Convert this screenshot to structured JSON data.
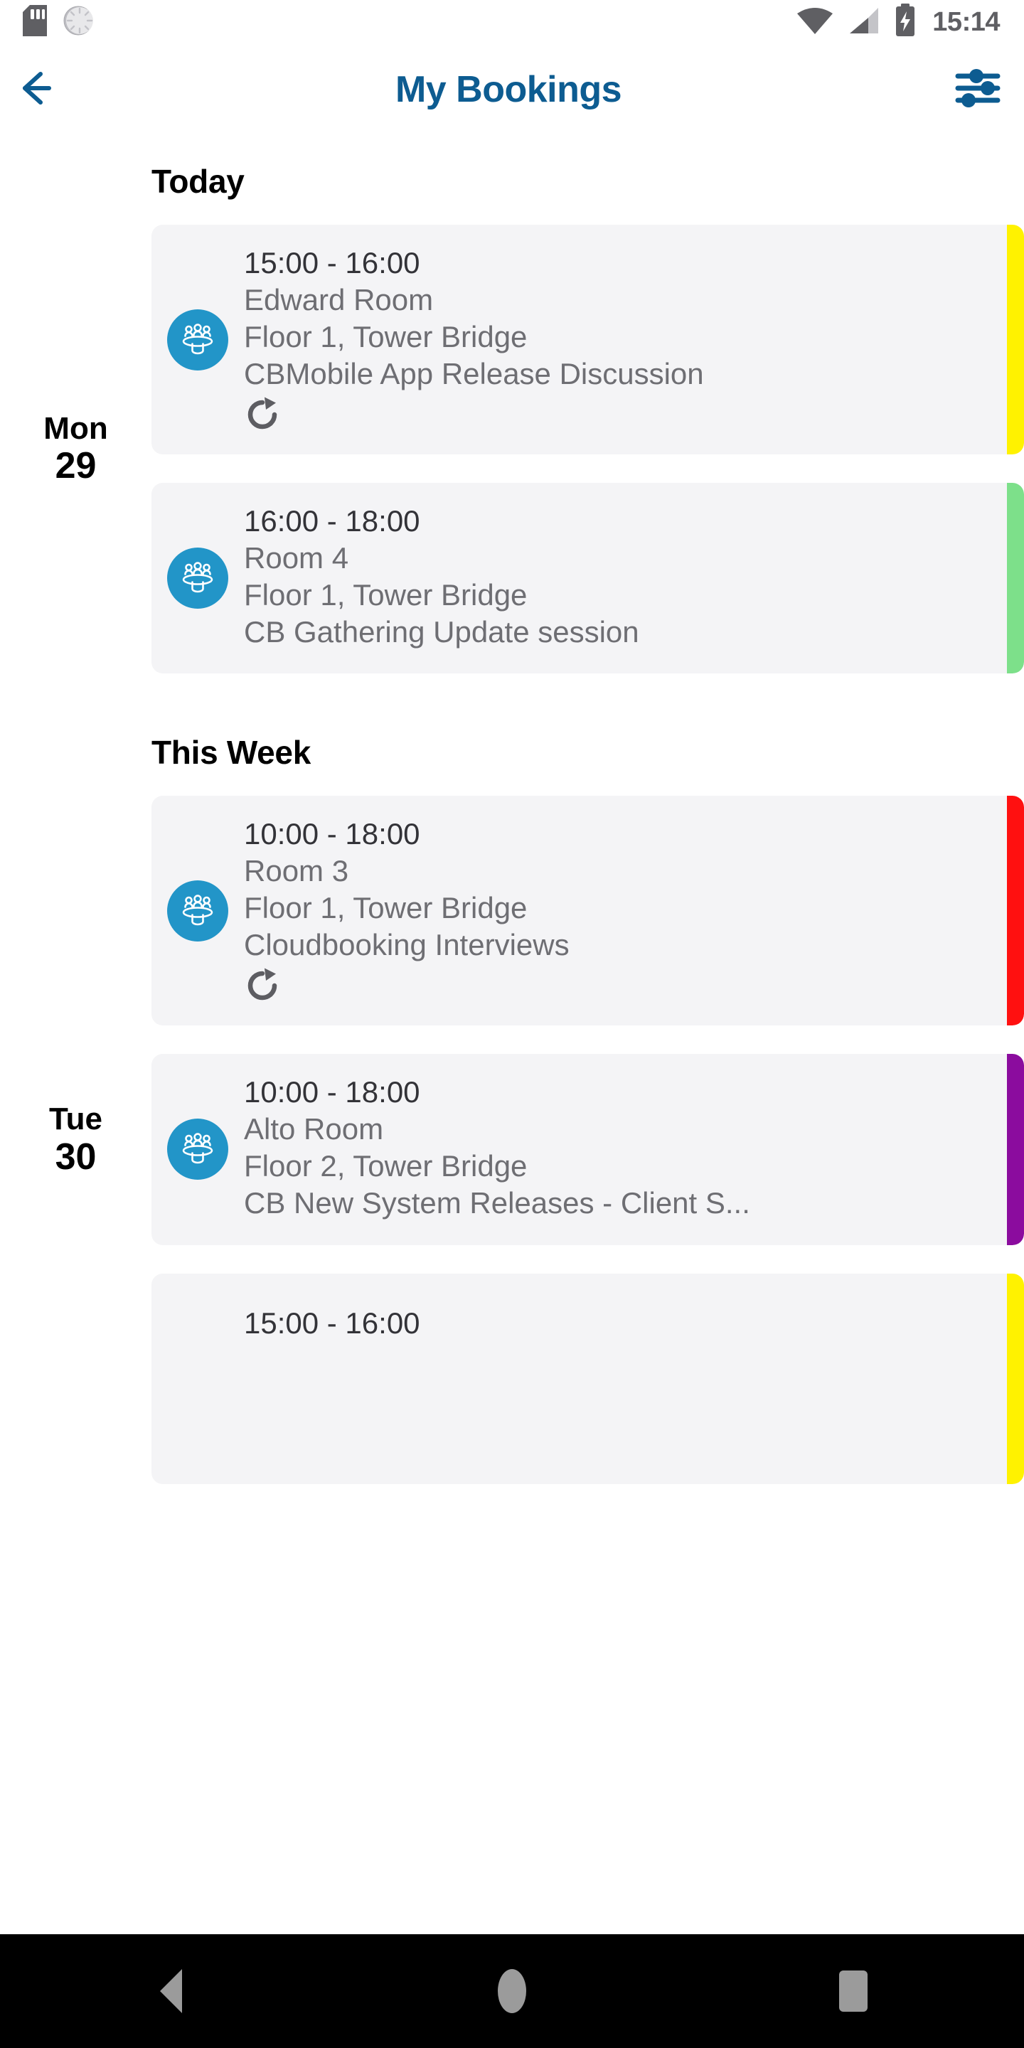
{
  "status_bar": {
    "icons_left": [
      "sd-card-icon",
      "sync-spinner-icon"
    ],
    "icons_right": [
      "wifi-icon",
      "cellular-signal-icon",
      "battery-charging-icon"
    ],
    "clock": "15:14"
  },
  "header": {
    "back_icon": "back-arrow-icon",
    "title": "My Bookings",
    "filter_icon": "filter-sliders-icon",
    "accent_color": "#0d5c91"
  },
  "colors": {
    "card_bg": "#f4f4f6",
    "icon_blue": "#2295c8",
    "time_text": "#333338",
    "detail_text": "#6e6e73"
  },
  "sections": [
    {
      "heading": "Today",
      "days": [
        {
          "day_name": "Mon",
          "day_num": "29",
          "bookings": [
            {
              "time": "15:00 - 16:00",
              "room": "Edward Room",
              "location": "Floor 1, Tower Bridge",
              "subject": "CBMobile App Release Discussion",
              "recurring": true,
              "accent": "#fff200",
              "icon": "meeting-room-icon"
            },
            {
              "time": "16:00 - 18:00",
              "room": "Room 4",
              "location": "Floor 1, Tower Bridge",
              "subject": "CB Gathering Update session",
              "recurring": false,
              "accent": "#7de08a",
              "icon": "meeting-room-icon"
            }
          ]
        }
      ]
    },
    {
      "heading": "This Week",
      "days": [
        {
          "day_name": "Tue",
          "day_num": "30",
          "bookings": [
            {
              "time": "10:00 - 18:00",
              "room": "Room 3",
              "location": "Floor 1, Tower Bridge",
              "subject": "Cloudbooking Interviews",
              "recurring": true,
              "accent": "#ff1010",
              "icon": "meeting-room-icon"
            },
            {
              "time": "10:00 - 18:00",
              "room": "Alto Room",
              "location": "Floor 2, Tower Bridge",
              "subject": "CB New System Releases - Client S...",
              "recurring": false,
              "accent": "#8b0c9e",
              "icon": "meeting-room-icon"
            },
            {
              "time": "15:00 - 16:00",
              "room": "",
              "location": "",
              "subject": "",
              "recurring": false,
              "accent": "#fff200",
              "icon": "meeting-room-icon",
              "partial": true
            }
          ]
        }
      ]
    }
  ],
  "nav_bar": {
    "back_label": "back-button",
    "home_label": "home-button",
    "recents_label": "recents-button"
  }
}
